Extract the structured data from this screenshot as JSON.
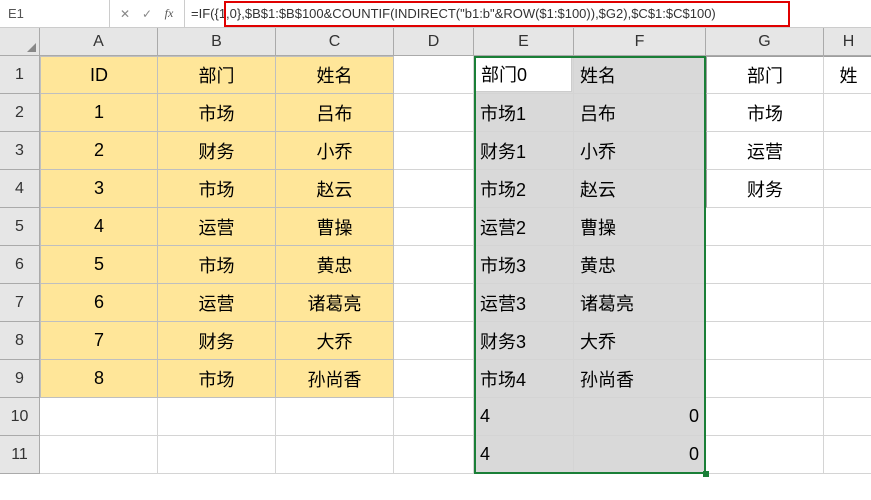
{
  "formula_bar": {
    "name_box": "E1",
    "cancel": "✕",
    "confirm": "✓",
    "fx": "fx",
    "formula": "=IF({1,0},$B$1:$B$100&COUNTIF(INDIRECT(\"b1:b\"&ROW($1:$100)),$G2),$C$1:$C$100)"
  },
  "col_headers": [
    "A",
    "B",
    "C",
    "D",
    "E",
    "F",
    "G",
    "H"
  ],
  "row_headers": [
    "1",
    "2",
    "3",
    "4",
    "5",
    "6",
    "7",
    "8",
    "9",
    "10",
    "11"
  ],
  "table_abc": {
    "header": {
      "a": "ID",
      "b": "部门",
      "c": "姓名"
    },
    "rows": [
      {
        "a": "1",
        "b": "市场",
        "c": "吕布"
      },
      {
        "a": "2",
        "b": "财务",
        "c": "小乔"
      },
      {
        "a": "3",
        "b": "市场",
        "c": "赵云"
      },
      {
        "a": "4",
        "b": "运营",
        "c": "曹操"
      },
      {
        "a": "5",
        "b": "市场",
        "c": "黄忠"
      },
      {
        "a": "6",
        "b": "运营",
        "c": "诸葛亮"
      },
      {
        "a": "7",
        "b": "财务",
        "c": "大乔"
      },
      {
        "a": "8",
        "b": "市场",
        "c": "孙尚香"
      }
    ]
  },
  "table_ef": {
    "rows": [
      {
        "e": "部门0",
        "f": "姓名"
      },
      {
        "e": "市场1",
        "f": "吕布"
      },
      {
        "e": "财务1",
        "f": "小乔"
      },
      {
        "e": "市场2",
        "f": "赵云"
      },
      {
        "e": "运营2",
        "f": "曹操"
      },
      {
        "e": "市场3",
        "f": "黄忠"
      },
      {
        "e": "运营3",
        "f": "诸葛亮"
      },
      {
        "e": "财务3",
        "f": "大乔"
      },
      {
        "e": "市场4",
        "f": "孙尚香"
      },
      {
        "e": "4",
        "f": "0"
      },
      {
        "e": "4",
        "f": "0"
      }
    ]
  },
  "table_g": {
    "header": {
      "g": "部门",
      "h": "姓"
    },
    "rows": [
      {
        "g": "市场"
      },
      {
        "g": "运营"
      },
      {
        "g": "财务"
      }
    ]
  },
  "active_cell_value": "部门0"
}
